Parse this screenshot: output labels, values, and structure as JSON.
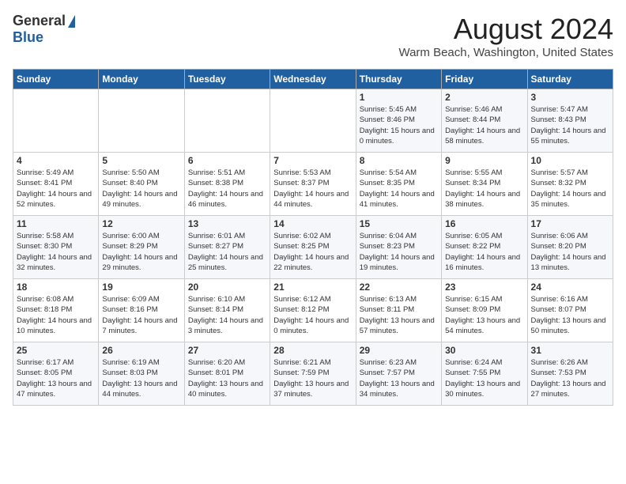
{
  "header": {
    "logo_general": "General",
    "logo_blue": "Blue",
    "month_title": "August 2024",
    "location": "Warm Beach, Washington, United States"
  },
  "days_of_week": [
    "Sunday",
    "Monday",
    "Tuesday",
    "Wednesday",
    "Thursday",
    "Friday",
    "Saturday"
  ],
  "weeks": [
    [
      {
        "num": "",
        "sunrise": "",
        "sunset": "",
        "daylight": ""
      },
      {
        "num": "",
        "sunrise": "",
        "sunset": "",
        "daylight": ""
      },
      {
        "num": "",
        "sunrise": "",
        "sunset": "",
        "daylight": ""
      },
      {
        "num": "",
        "sunrise": "",
        "sunset": "",
        "daylight": ""
      },
      {
        "num": "1",
        "sunrise": "Sunrise: 5:45 AM",
        "sunset": "Sunset: 8:46 PM",
        "daylight": "Daylight: 15 hours and 0 minutes."
      },
      {
        "num": "2",
        "sunrise": "Sunrise: 5:46 AM",
        "sunset": "Sunset: 8:44 PM",
        "daylight": "Daylight: 14 hours and 58 minutes."
      },
      {
        "num": "3",
        "sunrise": "Sunrise: 5:47 AM",
        "sunset": "Sunset: 8:43 PM",
        "daylight": "Daylight: 14 hours and 55 minutes."
      }
    ],
    [
      {
        "num": "4",
        "sunrise": "Sunrise: 5:49 AM",
        "sunset": "Sunset: 8:41 PM",
        "daylight": "Daylight: 14 hours and 52 minutes."
      },
      {
        "num": "5",
        "sunrise": "Sunrise: 5:50 AM",
        "sunset": "Sunset: 8:40 PM",
        "daylight": "Daylight: 14 hours and 49 minutes."
      },
      {
        "num": "6",
        "sunrise": "Sunrise: 5:51 AM",
        "sunset": "Sunset: 8:38 PM",
        "daylight": "Daylight: 14 hours and 46 minutes."
      },
      {
        "num": "7",
        "sunrise": "Sunrise: 5:53 AM",
        "sunset": "Sunset: 8:37 PM",
        "daylight": "Daylight: 14 hours and 44 minutes."
      },
      {
        "num": "8",
        "sunrise": "Sunrise: 5:54 AM",
        "sunset": "Sunset: 8:35 PM",
        "daylight": "Daylight: 14 hours and 41 minutes."
      },
      {
        "num": "9",
        "sunrise": "Sunrise: 5:55 AM",
        "sunset": "Sunset: 8:34 PM",
        "daylight": "Daylight: 14 hours and 38 minutes."
      },
      {
        "num": "10",
        "sunrise": "Sunrise: 5:57 AM",
        "sunset": "Sunset: 8:32 PM",
        "daylight": "Daylight: 14 hours and 35 minutes."
      }
    ],
    [
      {
        "num": "11",
        "sunrise": "Sunrise: 5:58 AM",
        "sunset": "Sunset: 8:30 PM",
        "daylight": "Daylight: 14 hours and 32 minutes."
      },
      {
        "num": "12",
        "sunrise": "Sunrise: 6:00 AM",
        "sunset": "Sunset: 8:29 PM",
        "daylight": "Daylight: 14 hours and 29 minutes."
      },
      {
        "num": "13",
        "sunrise": "Sunrise: 6:01 AM",
        "sunset": "Sunset: 8:27 PM",
        "daylight": "Daylight: 14 hours and 25 minutes."
      },
      {
        "num": "14",
        "sunrise": "Sunrise: 6:02 AM",
        "sunset": "Sunset: 8:25 PM",
        "daylight": "Daylight: 14 hours and 22 minutes."
      },
      {
        "num": "15",
        "sunrise": "Sunrise: 6:04 AM",
        "sunset": "Sunset: 8:23 PM",
        "daylight": "Daylight: 14 hours and 19 minutes."
      },
      {
        "num": "16",
        "sunrise": "Sunrise: 6:05 AM",
        "sunset": "Sunset: 8:22 PM",
        "daylight": "Daylight: 14 hours and 16 minutes."
      },
      {
        "num": "17",
        "sunrise": "Sunrise: 6:06 AM",
        "sunset": "Sunset: 8:20 PM",
        "daylight": "Daylight: 14 hours and 13 minutes."
      }
    ],
    [
      {
        "num": "18",
        "sunrise": "Sunrise: 6:08 AM",
        "sunset": "Sunset: 8:18 PM",
        "daylight": "Daylight: 14 hours and 10 minutes."
      },
      {
        "num": "19",
        "sunrise": "Sunrise: 6:09 AM",
        "sunset": "Sunset: 8:16 PM",
        "daylight": "Daylight: 14 hours and 7 minutes."
      },
      {
        "num": "20",
        "sunrise": "Sunrise: 6:10 AM",
        "sunset": "Sunset: 8:14 PM",
        "daylight": "Daylight: 14 hours and 3 minutes."
      },
      {
        "num": "21",
        "sunrise": "Sunrise: 6:12 AM",
        "sunset": "Sunset: 8:12 PM",
        "daylight": "Daylight: 14 hours and 0 minutes."
      },
      {
        "num": "22",
        "sunrise": "Sunrise: 6:13 AM",
        "sunset": "Sunset: 8:11 PM",
        "daylight": "Daylight: 13 hours and 57 minutes."
      },
      {
        "num": "23",
        "sunrise": "Sunrise: 6:15 AM",
        "sunset": "Sunset: 8:09 PM",
        "daylight": "Daylight: 13 hours and 54 minutes."
      },
      {
        "num": "24",
        "sunrise": "Sunrise: 6:16 AM",
        "sunset": "Sunset: 8:07 PM",
        "daylight": "Daylight: 13 hours and 50 minutes."
      }
    ],
    [
      {
        "num": "25",
        "sunrise": "Sunrise: 6:17 AM",
        "sunset": "Sunset: 8:05 PM",
        "daylight": "Daylight: 13 hours and 47 minutes."
      },
      {
        "num": "26",
        "sunrise": "Sunrise: 6:19 AM",
        "sunset": "Sunset: 8:03 PM",
        "daylight": "Daylight: 13 hours and 44 minutes."
      },
      {
        "num": "27",
        "sunrise": "Sunrise: 6:20 AM",
        "sunset": "Sunset: 8:01 PM",
        "daylight": "Daylight: 13 hours and 40 minutes."
      },
      {
        "num": "28",
        "sunrise": "Sunrise: 6:21 AM",
        "sunset": "Sunset: 7:59 PM",
        "daylight": "Daylight: 13 hours and 37 minutes."
      },
      {
        "num": "29",
        "sunrise": "Sunrise: 6:23 AM",
        "sunset": "Sunset: 7:57 PM",
        "daylight": "Daylight: 13 hours and 34 minutes."
      },
      {
        "num": "30",
        "sunrise": "Sunrise: 6:24 AM",
        "sunset": "Sunset: 7:55 PM",
        "daylight": "Daylight: 13 hours and 30 minutes."
      },
      {
        "num": "31",
        "sunrise": "Sunrise: 6:26 AM",
        "sunset": "Sunset: 7:53 PM",
        "daylight": "Daylight: 13 hours and 27 minutes."
      }
    ]
  ]
}
